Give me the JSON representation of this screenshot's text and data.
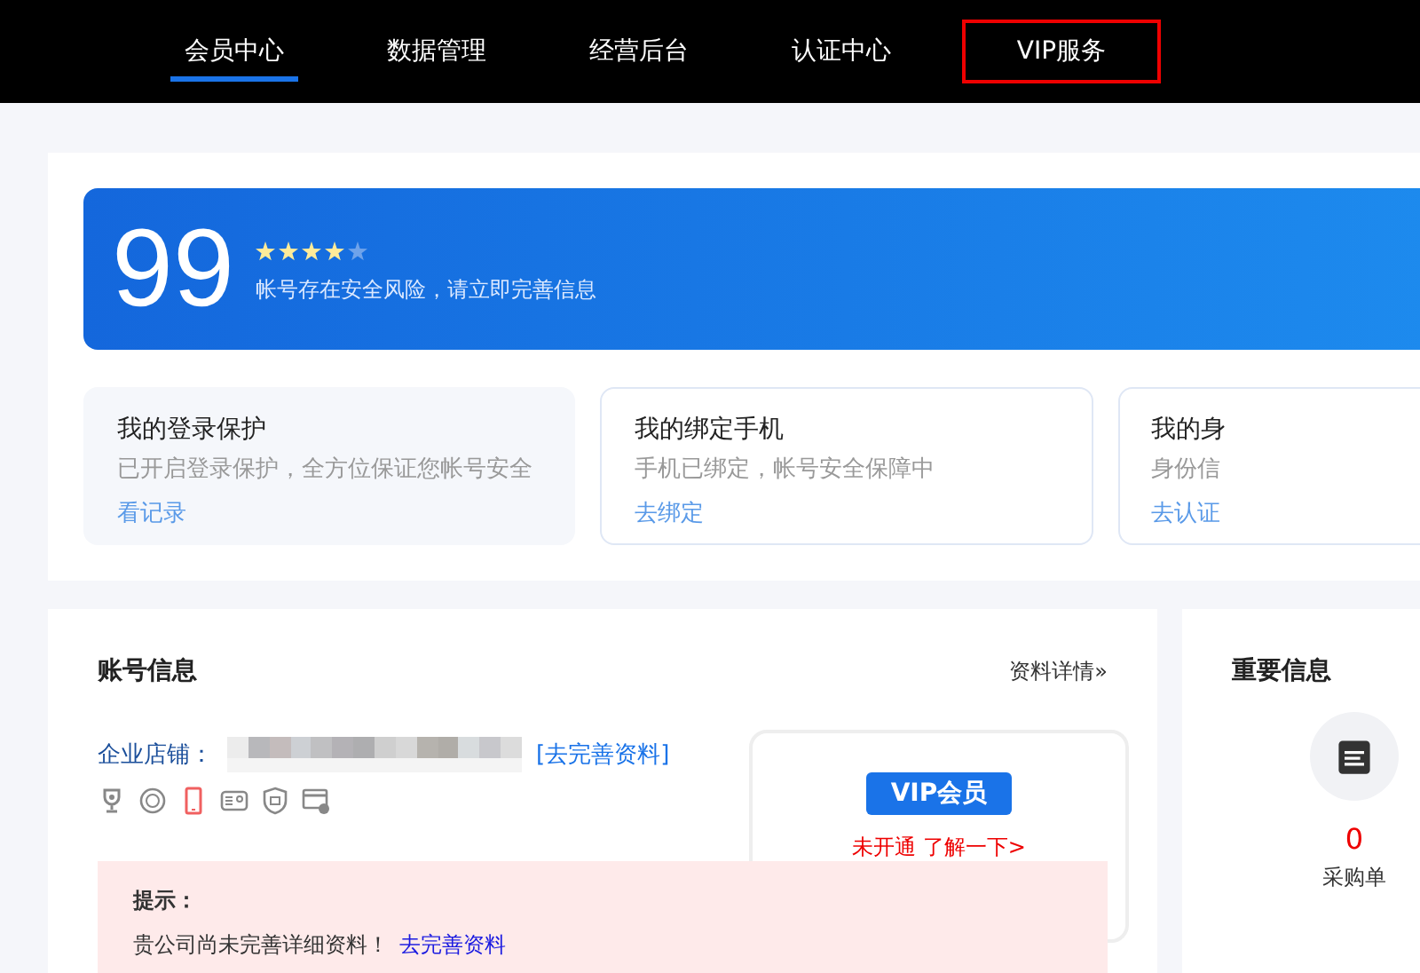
{
  "nav": [
    {
      "label": "会员中心",
      "selected": true,
      "highlighted": false
    },
    {
      "label": "数据管理",
      "selected": false,
      "highlighted": false
    },
    {
      "label": "经营后台",
      "selected": false,
      "highlighted": false
    },
    {
      "label": "认证中心",
      "selected": false,
      "highlighted": false
    },
    {
      "label": "VIP服务",
      "selected": false,
      "highlighted": true
    }
  ],
  "security": {
    "score": "99",
    "stars": 4,
    "message": "帐号存在安全风险，请立即完善信息",
    "cards": [
      {
        "title": "我的登录保护",
        "desc": "已开启登录保护，全方位保证您帐号安全",
        "link": "看记录",
        "selected": true
      },
      {
        "title": "我的绑定手机",
        "desc": "手机已绑定，帐号安全保障中",
        "link": "去绑定",
        "selected": false
      },
      {
        "title": "我的身",
        "desc": "身份信",
        "link": "去认证",
        "selected": false
      }
    ]
  },
  "account": {
    "title": "账号信息",
    "detail_link": "资料详情»",
    "shop_label": "企业店铺：",
    "complete_link": "[去完善资料]",
    "badges": [
      {
        "kind": "trophy",
        "active": false
      },
      {
        "kind": "seal",
        "active": false
      },
      {
        "kind": "phone",
        "active": true
      },
      {
        "kind": "idcard",
        "active": false
      },
      {
        "kind": "shield",
        "active": false
      },
      {
        "kind": "card",
        "active": false
      }
    ],
    "vip": {
      "badge": "VIP会员",
      "status": "未开通 了解一下>"
    },
    "tip": {
      "title": "提示：",
      "text": "贵公司尚未完善详细资料！",
      "link": "去完善资料"
    }
  },
  "important": {
    "title": "重要信息",
    "items": [
      {
        "count": "0",
        "label": "采购单"
      }
    ]
  }
}
